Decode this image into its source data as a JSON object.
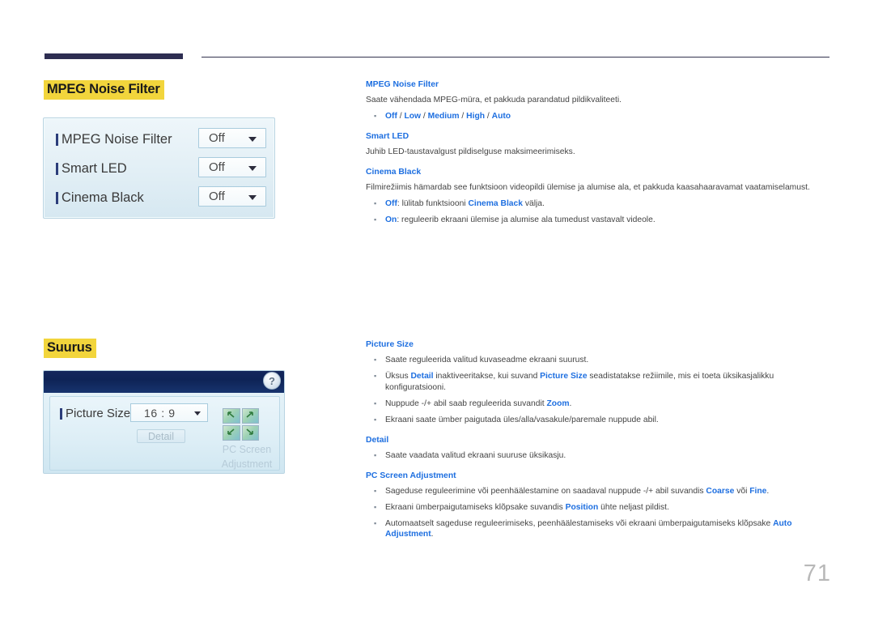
{
  "page": {
    "number": "71"
  },
  "sections": [
    {
      "heading": "MPEG Noise Filter",
      "osd": {
        "rows": [
          {
            "label": "MPEG Noise Filter",
            "value": "Off"
          },
          {
            "label": "Smart LED",
            "value": "Off"
          },
          {
            "label": "Cinema Black",
            "value": "Off"
          }
        ]
      }
    },
    {
      "heading": "Suurus",
      "osd": {
        "help_icon": "?",
        "picture_size_label": "Picture Size",
        "picture_size_value": "16 : 9",
        "detail_button": "Detail",
        "pc_screen_adjustment": "PC Screen Adjustment"
      }
    }
  ],
  "descriptions": {
    "mpeg_noise_filter": {
      "title": "MPEG Noise Filter",
      "paragraph": "Saate vähendada MPEG-müra, et pakkuda parandatud pildikvaliteeti.",
      "options": [
        "Off",
        "Low",
        "Medium",
        "High",
        "Auto"
      ],
      "options_separator": " / "
    },
    "smart_led": {
      "title": "Smart LED",
      "paragraph": "Juhib LED-taustavalgust pildiselguse maksimeerimiseks."
    },
    "cinema_black": {
      "title": "Cinema Black",
      "paragraph": "Filmirežiimis hämardab see funktsioon videopildi ülemise ja alumise ala, et pakkuda kaasahaaravamat vaatamiselamust.",
      "bullets": [
        {
          "bold1": "Off",
          "text1": ": lülitab funktsiooni ",
          "bold2": "Cinema Black",
          "text2": " välja."
        },
        {
          "bold1": "On",
          "text1": ": reguleerib ekraani ülemise ja alumise ala tumedust vastavalt videole.",
          "bold2": "",
          "text2": ""
        }
      ]
    },
    "picture_size": {
      "title": "Picture Size",
      "bullets": [
        {
          "parts": [
            {
              "t": "Saate reguleerida valitud kuvaseadme ekraani suurust.",
              "b": false
            }
          ]
        },
        {
          "parts": [
            {
              "t": "Üksus ",
              "b": false
            },
            {
              "t": "Detail",
              "b": true
            },
            {
              "t": " inaktiveeritakse, kui suvand ",
              "b": false
            },
            {
              "t": "Picture Size",
              "b": true
            },
            {
              "t": " seadistatakse režiimile, mis ei toeta üksikasjalikku konfiguratsiooni.",
              "b": false
            }
          ]
        },
        {
          "parts": [
            {
              "t": "Nuppude -/+ abil saab reguleerida suvandit ",
              "b": false
            },
            {
              "t": "Zoom",
              "b": true
            },
            {
              "t": ".",
              "b": false
            }
          ]
        },
        {
          "parts": [
            {
              "t": "Ekraani saate ümber paigutada üles/alla/vasakule/paremale nuppude abil.",
              "b": false
            }
          ]
        }
      ]
    },
    "detail": {
      "title": "Detail",
      "bullets": [
        {
          "parts": [
            {
              "t": "Saate vaadata valitud ekraani suuruse üksikasju.",
              "b": false
            }
          ]
        }
      ]
    },
    "pc_screen_adjustment": {
      "title": "PC Screen Adjustment",
      "bullets": [
        {
          "parts": [
            {
              "t": "Sageduse reguleerimine või peenhäälestamine on saadaval nuppude -/+ abil suvandis ",
              "b": false
            },
            {
              "t": "Coarse",
              "b": true
            },
            {
              "t": " või ",
              "b": false
            },
            {
              "t": "Fine",
              "b": true
            },
            {
              "t": ".",
              "b": false
            }
          ]
        },
        {
          "parts": [
            {
              "t": "Ekraani ümberpaigutamiseks klõpsake suvandis ",
              "b": false
            },
            {
              "t": "Position",
              "b": true
            },
            {
              "t": " ühte neljast pildist.",
              "b": false
            }
          ]
        },
        {
          "parts": [
            {
              "t": "Automaatselt sageduse reguleerimiseks, peenhäälestamiseks või ekraani ümberpaigutamiseks klõpsake ",
              "b": false
            },
            {
              "t": "Auto Adjustment",
              "b": true
            },
            {
              "t": ".",
              "b": false
            }
          ]
        }
      ]
    }
  },
  "colors": {
    "highlight": "#f2d53c",
    "heading_blue": "#1e6fe0",
    "header_bar": "#2e2e52",
    "osd_titlebar": "#13265c"
  }
}
